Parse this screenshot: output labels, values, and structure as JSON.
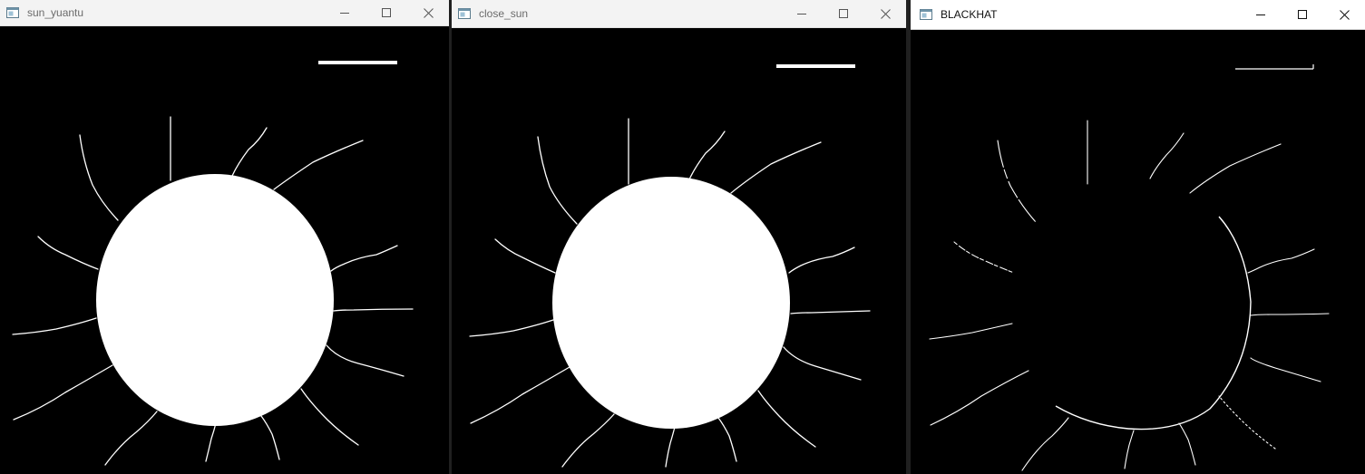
{
  "windows": [
    {
      "title": "sun_yuantu",
      "variant": "filled"
    },
    {
      "title": "close_sun",
      "variant": "filled"
    },
    {
      "title": "BLACKHAT",
      "variant": "outline"
    }
  ],
  "icons": {
    "app": "opencv-window-icon",
    "minimize": "minimize-icon",
    "maximize": "maximize-icon",
    "close": "close-icon"
  },
  "colors": {
    "canvas_background": "#000000",
    "foreground": "#ffffff",
    "titlebar_inactive": "#f3f3f3",
    "titlebar_active": "#ffffff"
  }
}
